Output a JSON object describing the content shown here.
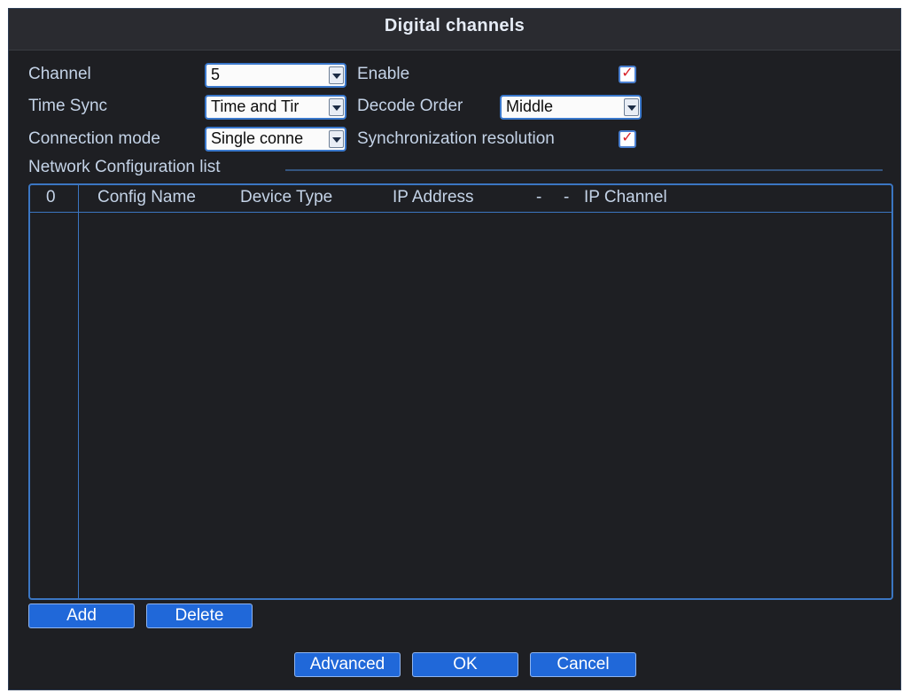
{
  "dialog": {
    "title": "Digital channels"
  },
  "form": {
    "channel_label": "Channel",
    "channel_value": "5",
    "enable_label": "Enable",
    "enable_checked": true,
    "time_sync_label": "Time Sync",
    "time_sync_value": "Time and Tir",
    "decode_order_label": "Decode Order",
    "decode_order_value": "Middle",
    "connection_mode_label": "Connection mode",
    "connection_mode_value": "Single conne",
    "sync_resolution_label": "Synchronization resolution",
    "sync_resolution_checked": true
  },
  "list": {
    "title": "Network Configuration list",
    "index_header": "0",
    "columns": [
      "Config Name",
      "Device Type",
      "IP Address",
      "-",
      "-",
      "IP Channel"
    ],
    "rows": []
  },
  "buttons": {
    "add": "Add",
    "delete": "Delete",
    "advanced": "Advanced",
    "ok": "OK",
    "cancel": "Cancel"
  },
  "colors": {
    "background": "#1e1f23",
    "accent": "#3b76c2",
    "button": "#2068d9",
    "check": "#d81f26",
    "text": "#c4d3e7"
  }
}
